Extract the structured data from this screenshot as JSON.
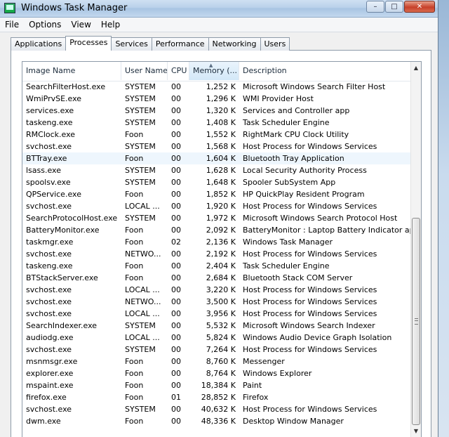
{
  "window": {
    "title": "Windows Task Manager"
  },
  "caption_buttons": {
    "minimize": "–",
    "maximize": "□",
    "close": "✕"
  },
  "menu": [
    "File",
    "Options",
    "View",
    "Help"
  ],
  "tabs": [
    {
      "label": "Applications",
      "active": false
    },
    {
      "label": "Processes",
      "active": true
    },
    {
      "label": "Services",
      "active": false
    },
    {
      "label": "Performance",
      "active": false
    },
    {
      "label": "Networking",
      "active": false
    },
    {
      "label": "Users",
      "active": false
    }
  ],
  "columns": {
    "image_name": "Image Name",
    "user_name": "User Name",
    "cpu": "CPU",
    "memory": "Memory (...",
    "description": "Description"
  },
  "sort_indicator": "▲",
  "scrollbar": {
    "up": "▲",
    "down": "▼"
  },
  "processes": [
    {
      "name": "SearchFilterHost.exe",
      "user": "SYSTEM",
      "cpu": "00",
      "mem": "1,252 K",
      "desc": "Microsoft Windows Search Filter Host"
    },
    {
      "name": "WmiPrvSE.exe",
      "user": "SYSTEM",
      "cpu": "00",
      "mem": "1,296 K",
      "desc": "WMI Provider Host"
    },
    {
      "name": "services.exe",
      "user": "SYSTEM",
      "cpu": "00",
      "mem": "1,320 K",
      "desc": "Services and Controller app"
    },
    {
      "name": "taskeng.exe",
      "user": "SYSTEM",
      "cpu": "00",
      "mem": "1,408 K",
      "desc": "Task Scheduler Engine"
    },
    {
      "name": "RMClock.exe",
      "user": "Foon",
      "cpu": "00",
      "mem": "1,552 K",
      "desc": "RightMark CPU Clock Utility"
    },
    {
      "name": "svchost.exe",
      "user": "SYSTEM",
      "cpu": "00",
      "mem": "1,568 K",
      "desc": "Host Process for Windows Services"
    },
    {
      "name": "BTTray.exe",
      "user": "Foon",
      "cpu": "00",
      "mem": "1,604 K",
      "desc": "Bluetooth Tray Application",
      "selected": true
    },
    {
      "name": "lsass.exe",
      "user": "SYSTEM",
      "cpu": "00",
      "mem": "1,628 K",
      "desc": "Local Security Authority Process"
    },
    {
      "name": "spoolsv.exe",
      "user": "SYSTEM",
      "cpu": "00",
      "mem": "1,648 K",
      "desc": "Spooler SubSystem App"
    },
    {
      "name": "QPService.exe",
      "user": "Foon",
      "cpu": "00",
      "mem": "1,852 K",
      "desc": "HP QuickPlay Resident Program"
    },
    {
      "name": "svchost.exe",
      "user": "LOCAL ...",
      "cpu": "00",
      "mem": "1,920 K",
      "desc": "Host Process for Windows Services"
    },
    {
      "name": "SearchProtocolHost.exe",
      "user": "SYSTEM",
      "cpu": "00",
      "mem": "1,972 K",
      "desc": "Microsoft Windows Search Protocol Host"
    },
    {
      "name": "BatteryMonitor.exe",
      "user": "Foon",
      "cpu": "00",
      "mem": "2,092 K",
      "desc": "BatteryMonitor : Laptop Battery Indicator applic..."
    },
    {
      "name": "taskmgr.exe",
      "user": "Foon",
      "cpu": "02",
      "mem": "2,136 K",
      "desc": "Windows Task Manager"
    },
    {
      "name": "svchost.exe",
      "user": "NETWO...",
      "cpu": "00",
      "mem": "2,192 K",
      "desc": "Host Process for Windows Services"
    },
    {
      "name": "taskeng.exe",
      "user": "Foon",
      "cpu": "00",
      "mem": "2,404 K",
      "desc": "Task Scheduler Engine"
    },
    {
      "name": "BTStackServer.exe",
      "user": "Foon",
      "cpu": "00",
      "mem": "2,684 K",
      "desc": "Bluetooth Stack COM Server"
    },
    {
      "name": "svchost.exe",
      "user": "LOCAL ...",
      "cpu": "00",
      "mem": "3,220 K",
      "desc": "Host Process for Windows Services"
    },
    {
      "name": "svchost.exe",
      "user": "NETWO...",
      "cpu": "00",
      "mem": "3,500 K",
      "desc": "Host Process for Windows Services"
    },
    {
      "name": "svchost.exe",
      "user": "LOCAL ...",
      "cpu": "00",
      "mem": "3,956 K",
      "desc": "Host Process for Windows Services"
    },
    {
      "name": "SearchIndexer.exe",
      "user": "SYSTEM",
      "cpu": "00",
      "mem": "5,532 K",
      "desc": "Microsoft Windows Search Indexer"
    },
    {
      "name": "audiodg.exe",
      "user": "LOCAL ...",
      "cpu": "00",
      "mem": "5,824 K",
      "desc": "Windows Audio Device Graph Isolation"
    },
    {
      "name": "svchost.exe",
      "user": "SYSTEM",
      "cpu": "00",
      "mem": "7,264 K",
      "desc": "Host Process for Windows Services"
    },
    {
      "name": "msnmsgr.exe",
      "user": "Foon",
      "cpu": "00",
      "mem": "8,760 K",
      "desc": "Messenger"
    },
    {
      "name": "explorer.exe",
      "user": "Foon",
      "cpu": "00",
      "mem": "8,764 K",
      "desc": "Windows Explorer"
    },
    {
      "name": "mspaint.exe",
      "user": "Foon",
      "cpu": "00",
      "mem": "18,384 K",
      "desc": "Paint"
    },
    {
      "name": "firefox.exe",
      "user": "Foon",
      "cpu": "01",
      "mem": "28,852 K",
      "desc": "Firefox"
    },
    {
      "name": "svchost.exe",
      "user": "SYSTEM",
      "cpu": "00",
      "mem": "40,632 K",
      "desc": "Host Process for Windows Services"
    },
    {
      "name": "dwm.exe",
      "user": "Foon",
      "cpu": "00",
      "mem": "48,336 K",
      "desc": "Desktop Window Manager"
    }
  ]
}
